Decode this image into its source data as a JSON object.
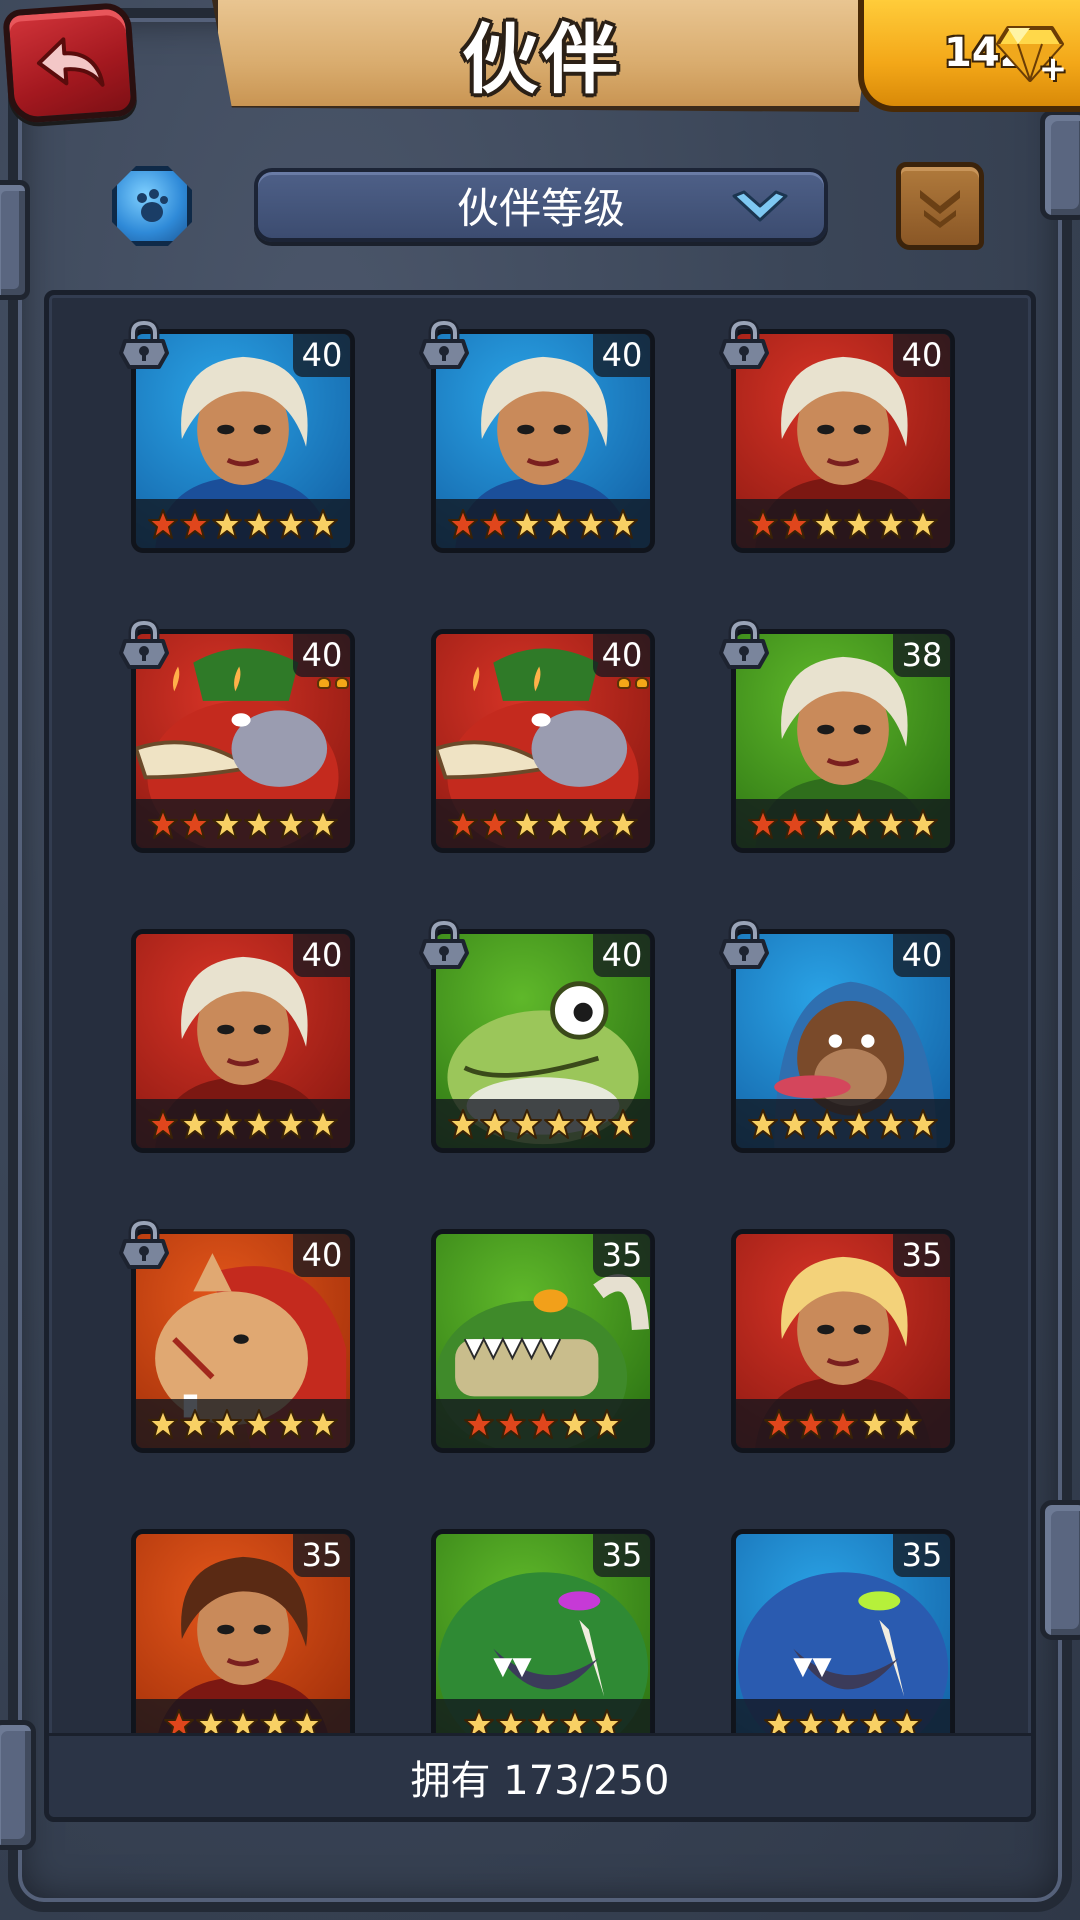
{
  "header": {
    "title": "伙伴",
    "gem_count": "142"
  },
  "toolbar": {
    "sort_label": "伙伴等级"
  },
  "footer": {
    "owned_text": "拥有 173/250"
  },
  "colors": {
    "blue_bg": "#2aa3e6",
    "red_bg": "#d63326",
    "green_bg": "#5fb82a",
    "orange_bg": "#e3561a",
    "star_gold": "#f8d064",
    "star_red": "#e0461c"
  },
  "companions": [
    {
      "level": "40",
      "bg": "blue",
      "portrait": "white-haired-hooded-woman-blue",
      "stars_total": 6,
      "stars_red": 2,
      "locked": true,
      "pips": false
    },
    {
      "level": "40",
      "bg": "blue",
      "portrait": "white-haired-hooded-woman-blue",
      "stars_total": 6,
      "stars_red": 2,
      "locked": true,
      "pips": false
    },
    {
      "level": "40",
      "bg": "red",
      "portrait": "skull-masked-shaman",
      "stars_total": 6,
      "stars_red": 2,
      "locked": true,
      "pips": false
    },
    {
      "level": "40",
      "bg": "red",
      "portrait": "red-tusked-boar-beast",
      "stars_total": 6,
      "stars_red": 2,
      "locked": true,
      "pips": true
    },
    {
      "level": "40",
      "bg": "red",
      "portrait": "red-tusked-boar-beast",
      "stars_total": 6,
      "stars_red": 2,
      "locked": false,
      "pips": true
    },
    {
      "level": "38",
      "bg": "green",
      "portrait": "white-haired-hooded-woman-green",
      "stars_total": 6,
      "stars_red": 2,
      "locked": true,
      "pips": false
    },
    {
      "level": "40",
      "bg": "red",
      "portrait": "skull-masked-shaman",
      "stars_total": 6,
      "stars_red": 1,
      "locked": false,
      "pips": false
    },
    {
      "level": "40",
      "bg": "green",
      "portrait": "green-frog-creature",
      "stars_total": 6,
      "stars_red": 0,
      "locked": true,
      "pips": false
    },
    {
      "level": "40",
      "bg": "blue",
      "portrait": "blue-hooded-monkey",
      "stars_total": 6,
      "stars_red": 0,
      "locked": true,
      "pips": false
    },
    {
      "level": "40",
      "bg": "orange",
      "portrait": "scarred-lion-warrior",
      "stars_total": 6,
      "stars_red": 0,
      "locked": true,
      "pips": false
    },
    {
      "level": "35",
      "bg": "green",
      "portrait": "green-crocodile-brute",
      "stars_total": 5,
      "stars_red": 3,
      "locked": false,
      "pips": false
    },
    {
      "level": "35",
      "bg": "red",
      "portrait": "blonde-horned-warrior-woman",
      "stars_total": 5,
      "stars_red": 3,
      "locked": false,
      "pips": false
    },
    {
      "level": "35",
      "bg": "orange",
      "portrait": "long-haired-smirking-man",
      "stars_total": 5,
      "stars_red": 1,
      "locked": false,
      "pips": false
    },
    {
      "level": "35",
      "bg": "green",
      "portrait": "green-saber-tooth-beast",
      "stars_total": 5,
      "stars_red": 0,
      "locked": false,
      "pips": false
    },
    {
      "level": "35",
      "bg": "blue",
      "portrait": "blue-saber-tooth-beast",
      "stars_total": 5,
      "stars_red": 0,
      "locked": false,
      "pips": false
    }
  ]
}
